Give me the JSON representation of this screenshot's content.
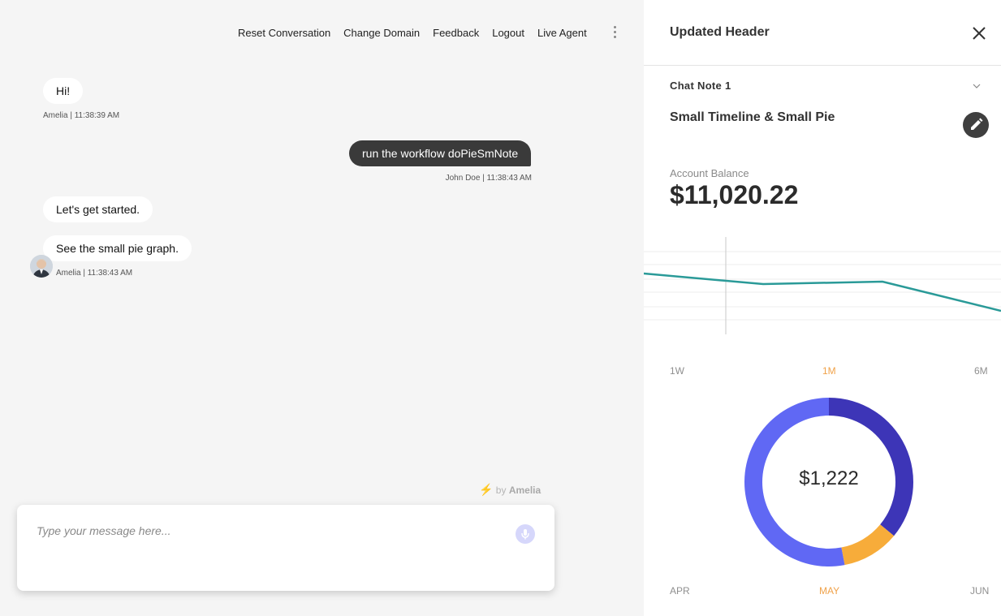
{
  "nav": {
    "items": [
      "Reset Conversation",
      "Change Domain",
      "Feedback",
      "Logout",
      "Live Agent"
    ],
    "more_icon": "more-vertical-icon"
  },
  "messages": [
    {
      "text": "Hi!",
      "meta": "Amelia | 11:38:39 AM"
    },
    {
      "text": "run the workflow doPieSmNote",
      "meta": "John Doe | 11:38:43 AM"
    },
    {
      "text": "Let's get started."
    },
    {
      "text": "See the small pie graph.",
      "meta": "Amelia | 11:38:43 AM"
    }
  ],
  "powered": {
    "by": "by",
    "brand": "Amelia"
  },
  "composer": {
    "placeholder": "Type your message here...",
    "mic_icon": "microphone-icon"
  },
  "panel": {
    "header": "Updated Header",
    "note_title": "Chat Note 1",
    "section_title": "Small Timeline & Small Pie",
    "balance_label": "Account Balance",
    "balance_value": "$11,020.22",
    "ranges": [
      "1W",
      "1M",
      "6M"
    ],
    "active_range": "1M",
    "donut_center": "$1,222",
    "months": [
      "APR",
      "MAY",
      "JUN"
    ],
    "active_month": "MAY"
  },
  "chart_data": [
    {
      "type": "line",
      "title": "",
      "series": [
        {
          "values": [
            46,
            20,
            26,
            -46
          ]
        }
      ],
      "color": "#2a9a98",
      "grid": true
    },
    {
      "type": "pie",
      "slices": [
        {
          "value": 0.36,
          "color": "#3d35b7"
        },
        {
          "value": 0.11,
          "color": "#f7ac3a"
        },
        {
          "value": 0.53,
          "color": "#6068f4"
        }
      ],
      "center_label": "$1,222"
    }
  ]
}
